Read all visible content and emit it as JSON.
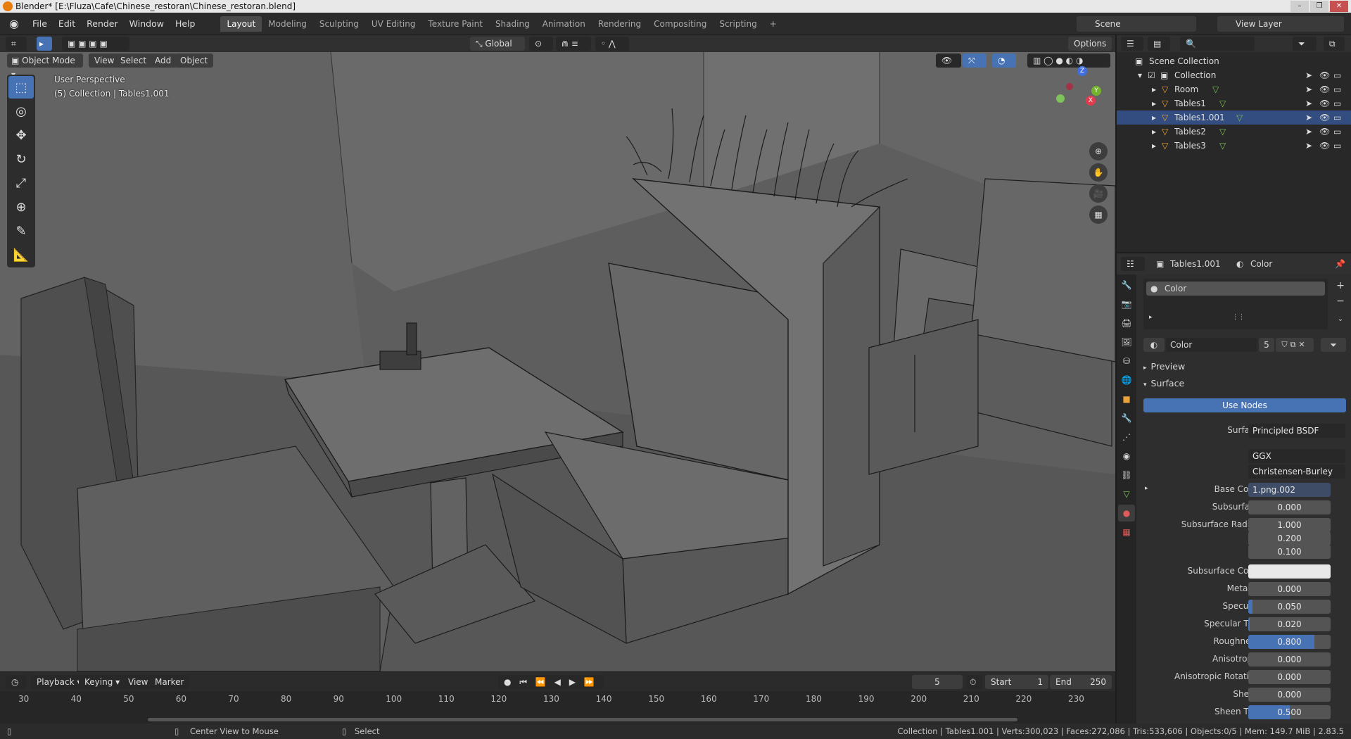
{
  "window": {
    "title": "Blender* [E:\\Fluza\\Cafe\\Chinese_restoran\\Chinese_restoran.blend]",
    "controls": [
      "–",
      "❐",
      "✕"
    ]
  },
  "menu": {
    "items": [
      "File",
      "Edit",
      "Render",
      "Window",
      "Help"
    ],
    "workspaces": [
      "Layout",
      "Modeling",
      "Sculpting",
      "UV Editing",
      "Texture Paint",
      "Shading",
      "Animation",
      "Rendering",
      "Compositing",
      "Scripting"
    ],
    "active_workspace": "Layout",
    "add_tab": "+",
    "scene": "Scene",
    "view_layer": "View Layer"
  },
  "viewport_header": {
    "transform_orientation": "Global",
    "options": "Options",
    "mode": "Object Mode",
    "menus": [
      "View",
      "Select",
      "Add",
      "Object"
    ]
  },
  "viewport": {
    "perspective": "User Perspective",
    "collection_info": "(5) Collection | Tables1.001",
    "gizmo_axes": [
      "X",
      "Y",
      "Z"
    ]
  },
  "tools": [
    {
      "name": "select-box-tool",
      "glyph": "⬚",
      "active": true
    },
    {
      "name": "cursor-tool",
      "glyph": "◎",
      "active": false
    },
    {
      "name": "move-tool",
      "glyph": "✥",
      "active": false
    },
    {
      "name": "rotate-tool",
      "glyph": "↻",
      "active": false
    },
    {
      "name": "scale-tool",
      "glyph": "⤢",
      "active": false
    },
    {
      "name": "transform-tool",
      "glyph": "⊕",
      "active": false
    },
    {
      "name": "annotate-tool",
      "glyph": "✎",
      "active": false
    },
    {
      "name": "measure-tool",
      "glyph": "📐",
      "active": false
    }
  ],
  "timeline": {
    "menus": [
      "Playback",
      "Keying",
      "View",
      "Marker"
    ],
    "current_frame": "5",
    "start_label": "Start",
    "start": "1",
    "end_label": "End",
    "end": "250",
    "ruler": [
      "30",
      "40",
      "50",
      "60",
      "70",
      "80",
      "90",
      "100",
      "110",
      "120",
      "130",
      "140",
      "150",
      "160",
      "170",
      "180",
      "190",
      "200",
      "210",
      "220",
      "230"
    ]
  },
  "status": {
    "hint1": "Center View to Mouse",
    "hint2": "Select",
    "stats": "Collection | Tables1.001 | Verts:300,023 | Faces:272,086 | Tris:533,606 | Objects:0/5 | Mem: 149.7 MiB | 2.83.5"
  },
  "outliner": {
    "root": "Scene Collection",
    "collection": "Collection",
    "objects": [
      "Room",
      "Tables1",
      "Tables1.001",
      "Tables2",
      "Tables3"
    ],
    "selected": "Tables1.001"
  },
  "properties": {
    "object_name": "Tables1.001",
    "material_name": "Color",
    "slot_name": "Color",
    "material_field": "Color",
    "user_count": "5",
    "panels": [
      "Preview",
      "Surface"
    ],
    "use_nodes": "Use Nodes",
    "surface_label": "Surface",
    "surface_shader": "Principled BSDF",
    "distribution": "GGX",
    "subsurface_method": "Christensen-Burley",
    "rows": [
      {
        "label": "Base Color",
        "value": "1.png.002",
        "fraction": 0
      },
      {
        "label": "Subsurface",
        "value": "0.000",
        "fraction": 0
      },
      {
        "label": "Subsurface Radius",
        "value": "1.000",
        "fraction": 0
      },
      {
        "label": "",
        "value": "0.200",
        "fraction": 0
      },
      {
        "label": "",
        "value": "0.100",
        "fraction": 0
      },
      {
        "label": "Subsurface Color",
        "value": "",
        "fraction": 0
      },
      {
        "label": "Metallic",
        "value": "0.000",
        "fraction": 0
      },
      {
        "label": "Specular",
        "value": "0.050",
        "fraction": 0.05
      },
      {
        "label": "Specular Tint",
        "value": "0.020",
        "fraction": 0.02
      },
      {
        "label": "Roughness",
        "value": "0.800",
        "fraction": 0.8
      },
      {
        "label": "Anisotropic",
        "value": "0.000",
        "fraction": 0
      },
      {
        "label": "Anisotropic Rotation",
        "value": "0.000",
        "fraction": 0
      },
      {
        "label": "Sheen",
        "value": "0.000",
        "fraction": 0
      },
      {
        "label": "Sheen Tint",
        "value": "0.500",
        "fraction": 0.5
      }
    ]
  },
  "colors": {
    "accent": "#4772b3",
    "selected_row": "#334d80",
    "object_orange": "#e8a33c",
    "mesh_green": "#7dc25a"
  }
}
